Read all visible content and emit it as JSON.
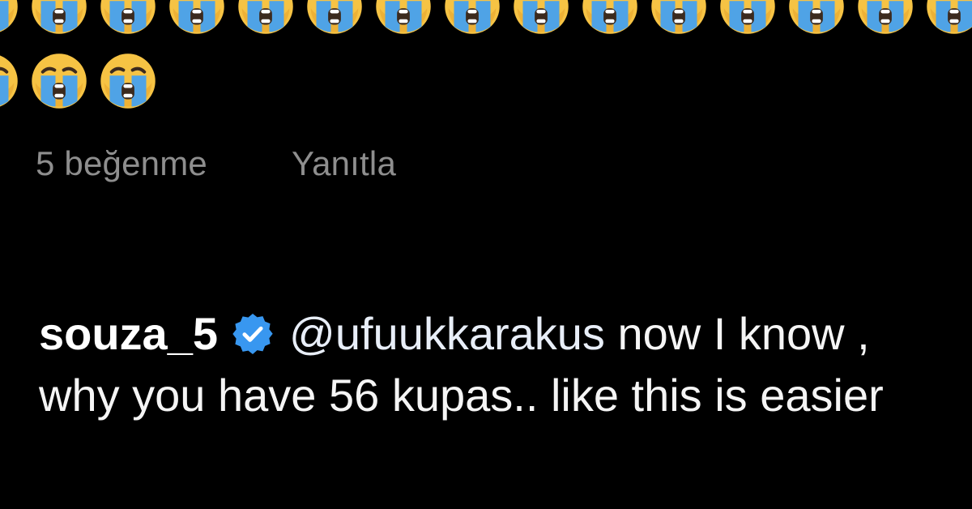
{
  "emoji": {
    "name": "loudly-crying-face",
    "row1_count": 15,
    "row2_count": 3,
    "colors": {
      "face": "#f6c344",
      "face_shadow": "#e5a22c",
      "tears": "#4fa3e6",
      "mouth": "#3b2a1e"
    }
  },
  "actions": {
    "likes_label": "5 beğenme",
    "reply_label": "Yanıtla"
  },
  "comment": {
    "username": "souza_5",
    "verified": true,
    "verified_color": "#3897f0",
    "mention": "@ufuukkarakus",
    "text": " now I know , why you have 56 kupas.. like this is easier"
  }
}
